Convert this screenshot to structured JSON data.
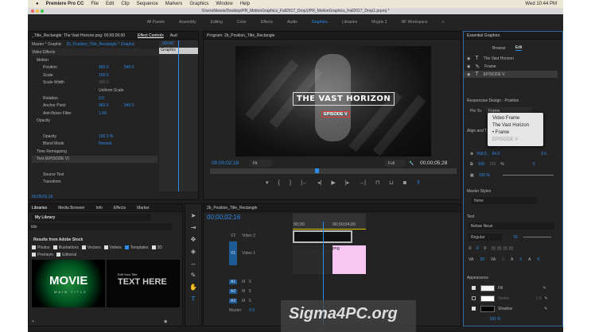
{
  "menubar": {
    "apple": "",
    "app": "Premiere Pro CC",
    "items": [
      "File",
      "Edit",
      "Clip",
      "Sequence",
      "Markers",
      "Graphics",
      "Window",
      "Help"
    ],
    "clock": "Wed 10:44 PM"
  },
  "window_title": "/Users/blewis/Desktop/PR_MotionGraphics_Fall2017_Drop1/PR_MotionGraphics_Fall2017_Drop1.prproj *",
  "workspaces": [
    "All Panels",
    "Assembly",
    "Editing",
    "Color",
    "Effects",
    "Audio",
    "Graphics",
    "Libraries",
    "Mogrts 2",
    "NF Workspace"
  ],
  "active_workspace": "Graphics",
  "effect_controls": {
    "source_tab": "_Title_Rectangle: The Vast Horizon.png: 00;00;00;00",
    "tab": "Effect Controls",
    "tab2": "Aud",
    "master": "Master * Graphic",
    "sequence": "2b_Position_Title_Rectangle * Graphic",
    "mini_time": ";00;00",
    "clip_label": "Graphic",
    "section": "Video Effects",
    "rows": [
      {
        "name": "Motion",
        "v1": "",
        "v2": ""
      },
      {
        "name": "Position",
        "v1": "960.0",
        "v2": "540.0"
      },
      {
        "name": "Scale",
        "v1": "100.0",
        "v2": ""
      },
      {
        "name": "Scale Width",
        "v1": "100.0",
        "v2": ""
      },
      {
        "name": "",
        "v1": "Uniform Scale",
        "v2": ""
      },
      {
        "name": "Rotation",
        "v1": "0.0",
        "v2": ""
      },
      {
        "name": "Anchor Point",
        "v1": "960.0",
        "v2": "540.0"
      },
      {
        "name": "Anti-flicker Filter",
        "v1": "1.00",
        "v2": ""
      },
      {
        "name": "Opacity",
        "v1": "",
        "v2": ""
      },
      {
        "name": "",
        "v1": "",
        "v2": ""
      },
      {
        "name": "Opacity",
        "v1": "100.0 %",
        "v2": ""
      },
      {
        "name": "Blend Mode",
        "v1": "Normal",
        "v2": ""
      },
      {
        "name": "Time Remapping",
        "v1": "",
        "v2": ""
      },
      {
        "name": "Text (EPISODE V)",
        "v1": "",
        "v2": ""
      },
      {
        "name": "",
        "v1": "",
        "v2": ""
      },
      {
        "name": "Source Text",
        "v1": "",
        "v2": ""
      },
      {
        "name": "Transform",
        "v1": "",
        "v2": ""
      }
    ],
    "timecode": "00;00;02;16"
  },
  "program": {
    "title": "Program: 2b_Position_Title_Rectangle",
    "video_title": "THE VAST HORIZON",
    "video_subtitle": "EPISODE V",
    "timecode": "00;00;02;16",
    "fit": "Fit",
    "quality": "Full",
    "duration": "00;00;05;28"
  },
  "libraries": {
    "tabs": [
      "Libraries",
      "Media Browser",
      "Info",
      "Effects",
      "Marker"
    ],
    "library": "My Library",
    "search": "title",
    "results_header": "Results from Adobe Stock",
    "filters": [
      {
        "label": "Photos",
        "on": false
      },
      {
        "label": "Illustrations",
        "on": false
      },
      {
        "label": "Vectors",
        "on": false
      },
      {
        "label": "Videos",
        "on": false
      },
      {
        "label": "Templates",
        "on": true
      },
      {
        "label": "3D",
        "on": false
      },
      {
        "label": "Premium",
        "on": false
      },
      {
        "label": "Editorial",
        "on": false
      }
    ],
    "thumbs": [
      {
        "big": "MOVIE",
        "small": "MAIN TITLE"
      },
      {
        "big": "TEXT HERE",
        "small": "Edit Your Title"
      }
    ]
  },
  "timeline": {
    "tab": "2b_Position_Title_Rectangle",
    "timecode": "00;00;02;16",
    "ruler": [
      "00;00",
      "00;00;04;00"
    ],
    "tracks": [
      {
        "id": "V2",
        "name": "Video 2"
      },
      {
        "id": "V1",
        "name": "Video 1"
      },
      {
        "id": "A1",
        "name": ""
      },
      {
        "id": "A2",
        "name": ""
      },
      {
        "id": "A3",
        "name": ""
      }
    ],
    "master": "Master",
    "master_value": "0.0",
    "clip": "The Vast Horizon.png"
  },
  "essential": {
    "title": "Essential Graphics",
    "tabs": [
      "Browse",
      "Edit"
    ],
    "active_tab": "Edit",
    "layers": [
      {
        "icon": "T",
        "name": "The Vast Horizon"
      },
      {
        "icon": "✎",
        "name": "Frame"
      },
      {
        "icon": "T",
        "name": "EPISODE V"
      }
    ],
    "responsive": "Responsive Design - Position",
    "pin_to_label": "Pin To:",
    "pin_to": "Frame",
    "dropdown": [
      "Video Frame",
      "The Vast Horizon",
      "Frame",
      "EPISODE V"
    ],
    "dropdown_selected": "Frame",
    "align": "Align and T",
    "pos_x": "958.0 ,",
    "pos_y": "64.0",
    "rot_val": "0.0 ,",
    "scale": "100",
    "scale2": "100",
    "pct": "%",
    "rotation": "0",
    "opacity": "100 %",
    "master_styles": "Master Styles",
    "master_style": "None",
    "text": "Text",
    "font": "Bebas Neue",
    "style": "Regular",
    "size": "70",
    "tracking": "30",
    "kerning": "0",
    "leading": "0",
    "baseline": "0",
    "appearance": "Appearance",
    "fill": "Fill",
    "stroke": "Stroke",
    "stroke_w": "1.0",
    "shadow": "Shadow",
    "shadow_opacity": "100 %"
  },
  "watermark": "Sigma4PC.org",
  "colors": {
    "accent": "#2d8ceb",
    "panel": "#232323",
    "clip_pink": "#f7c6f2",
    "playhead": "#2d8ceb"
  }
}
